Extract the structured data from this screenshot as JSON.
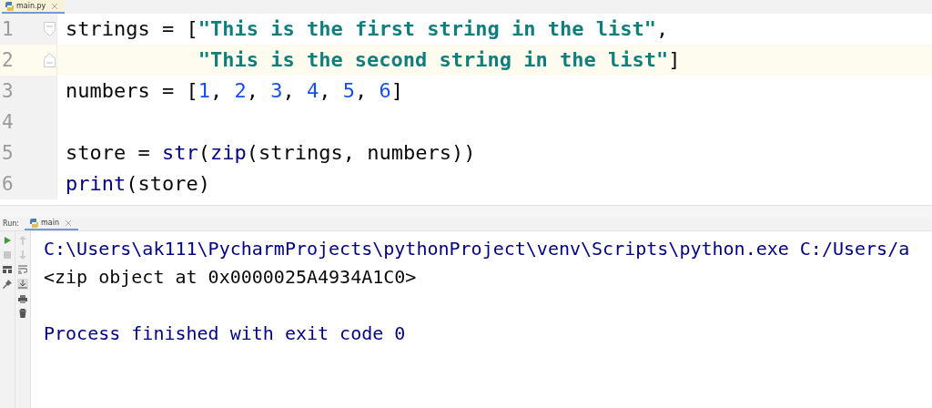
{
  "editor_tab": {
    "label": "main.py",
    "selected": true
  },
  "code_lines": [
    {
      "number": "1",
      "current": false,
      "fold_open": true,
      "tokens": [
        {
          "kind": "plain",
          "text": "strings = ["
        },
        {
          "kind": "string",
          "text": "\"This is the first string in the list\""
        },
        {
          "kind": "plain",
          "text": ","
        }
      ]
    },
    {
      "number": "2",
      "current": true,
      "fold_close": true,
      "continuation": true,
      "tokens": [
        {
          "kind": "string",
          "text": "\"This is the second string in the list\""
        },
        {
          "kind": "plain",
          "text": "]"
        }
      ]
    },
    {
      "number": "3",
      "current": false,
      "tokens": [
        {
          "kind": "plain",
          "text": "numbers = ["
        },
        {
          "kind": "number",
          "text": "1"
        },
        {
          "kind": "plain",
          "text": ", "
        },
        {
          "kind": "number",
          "text": "2"
        },
        {
          "kind": "plain",
          "text": ", "
        },
        {
          "kind": "number",
          "text": "3"
        },
        {
          "kind": "plain",
          "text": ", "
        },
        {
          "kind": "number",
          "text": "4"
        },
        {
          "kind": "plain",
          "text": ", "
        },
        {
          "kind": "number",
          "text": "5"
        },
        {
          "kind": "plain",
          "text": ", "
        },
        {
          "kind": "number",
          "text": "6"
        },
        {
          "kind": "plain",
          "text": "]"
        }
      ]
    },
    {
      "number": "4",
      "current": false
    },
    {
      "number": "5",
      "current": false,
      "tokens": [
        {
          "kind": "plain",
          "text": "store = "
        },
        {
          "kind": "builtin",
          "text": "str"
        },
        {
          "kind": "plain",
          "text": "("
        },
        {
          "kind": "builtin",
          "text": "zip"
        },
        {
          "kind": "plain",
          "text": "(strings, numbers))"
        }
      ]
    },
    {
      "number": "6",
      "current": false,
      "tokens": [
        {
          "kind": "builtin",
          "text": "print"
        },
        {
          "kind": "plain",
          "text": "(store)"
        }
      ]
    }
  ],
  "run_panel": {
    "label": "Run:",
    "tab": {
      "label": "main",
      "selected": true
    },
    "output": [
      {
        "kind": "system",
        "text": "C:\\Users\\ak111\\PycharmProjects\\pythonProject\\venv\\Scripts\\python.exe C:/Users/a"
      },
      {
        "kind": "stdout",
        "text": "<zip object at 0x0000025A4934A1C0>"
      },
      {
        "kind": "blank"
      },
      {
        "kind": "system",
        "text": "Process finished with exit code 0"
      }
    ]
  }
}
